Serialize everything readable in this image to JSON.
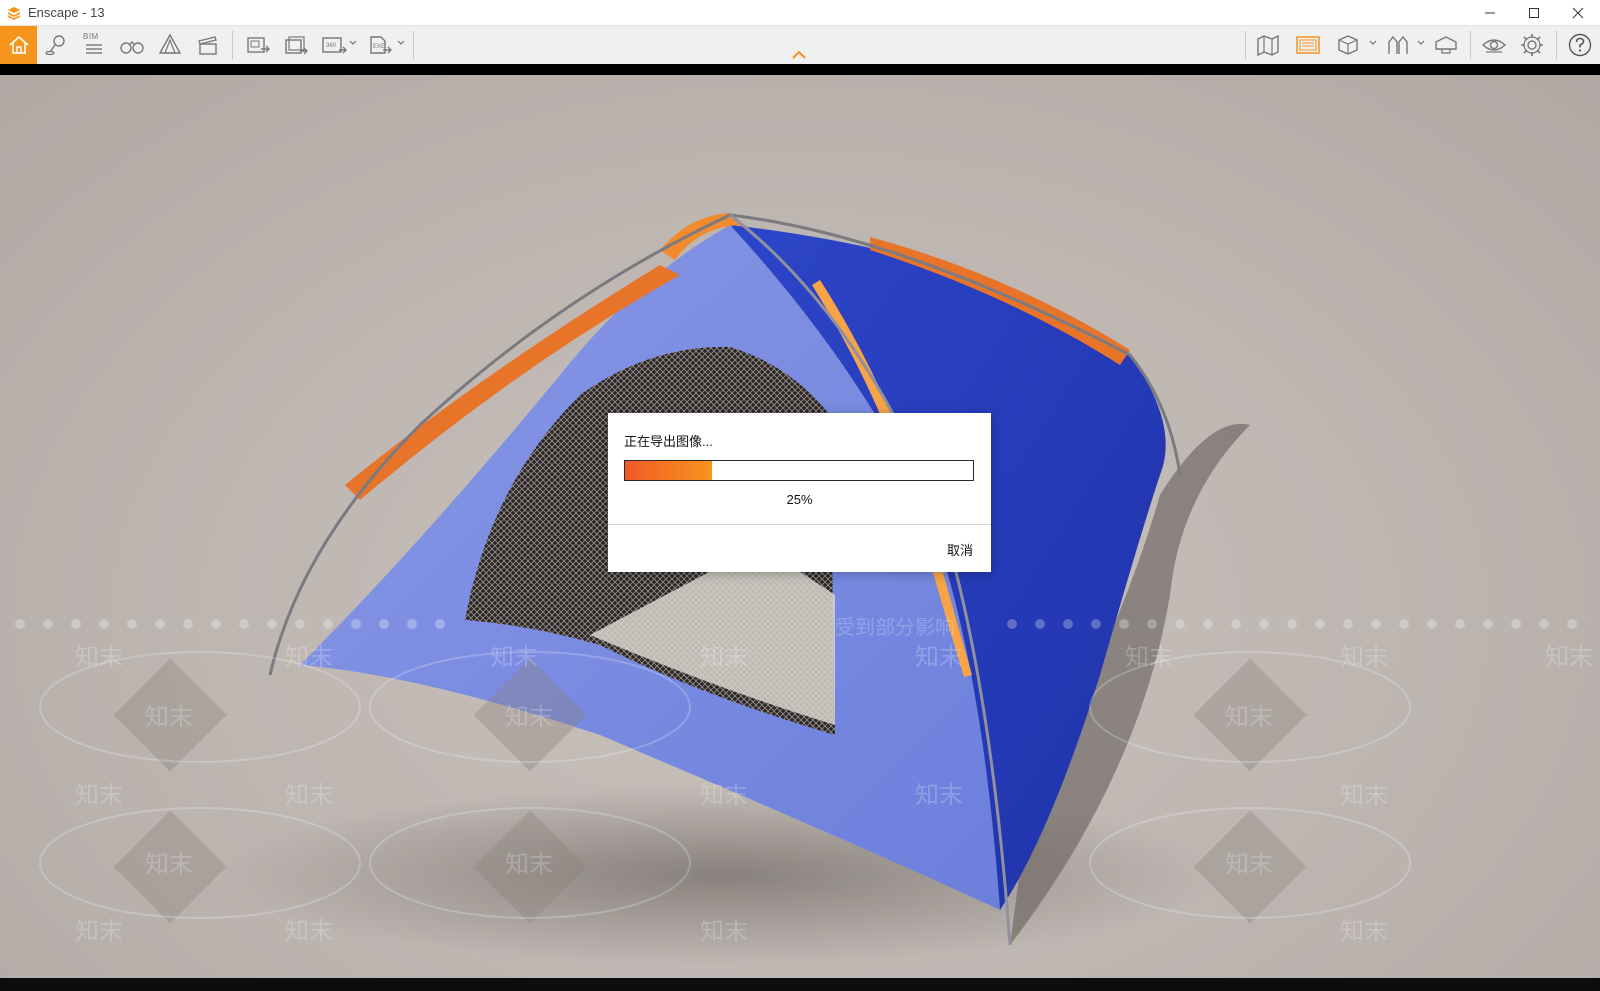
{
  "window": {
    "title": "Enscape - 13"
  },
  "toolbar": {
    "bim_label": "BIM",
    "left_tools": [
      "home-icon",
      "location-pin-icon",
      "bim-list-icon",
      "binoculars-icon",
      "asset-library-icon",
      "clapboard-icon",
      "screenshot-export-icon",
      "batch-render-icon",
      "panorama-360-icon",
      "export-exe-icon"
    ],
    "right_tools": [
      "map-icon",
      "safe-frame-icon",
      "view-cube-icon",
      "vr-icon",
      "vr-headset-icon",
      "visibility-eye-icon",
      "settings-gear-icon",
      "help-icon"
    ],
    "accent_color": "#f7941d"
  },
  "dialog": {
    "title": "正在导出图像...",
    "progress_percent": 25,
    "progress_label": "25%",
    "cancel_label": "取消"
  },
  "watermark": {
    "text": "知末",
    "caption": "受到部分影响"
  }
}
